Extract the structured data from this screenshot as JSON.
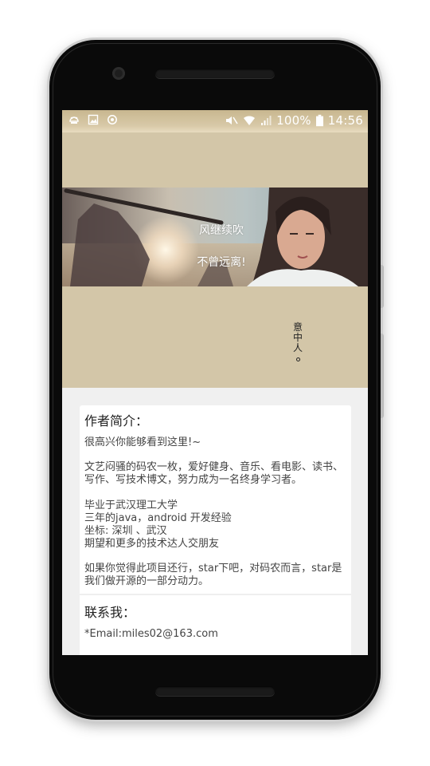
{
  "status_bar": {
    "battery_percent": "100%",
    "time": "14:56",
    "left_icons": [
      "android-debug-icon",
      "image-icon",
      "sync-icon"
    ],
    "right_icons": [
      "mute-icon",
      "wifi-icon",
      "signal-icon",
      "battery-icon"
    ]
  },
  "header": {
    "banner_line1": "风继续吹",
    "banner_line2": "不曾远离!",
    "seal_text": "意中人"
  },
  "about": {
    "title": "作者简介：",
    "greeting": "很高兴你能够看到这里!~",
    "intro": "文艺闷骚的码农一枚，爱好健身、音乐、看电影、读书、写作、写技术博文，努力成为一名终身学习者。",
    "school": "毕业于武汉理工大学",
    "experience": "三年的java，android 开发经验",
    "location": "坐标: 深圳 、武汉",
    "hope": "期望和更多的技术达人交朋友",
    "star_request": "如果你觉得此项目还行，star下吧，对码农而言，star是我们做开源的一部分动力。"
  },
  "contact": {
    "title": "联系我：",
    "email": "*Email:miles02@163.com"
  },
  "colors": {
    "header_bg": "#d3c6a8",
    "card_bg": "#ffffff",
    "screen_bg": "#f0f0f0"
  }
}
